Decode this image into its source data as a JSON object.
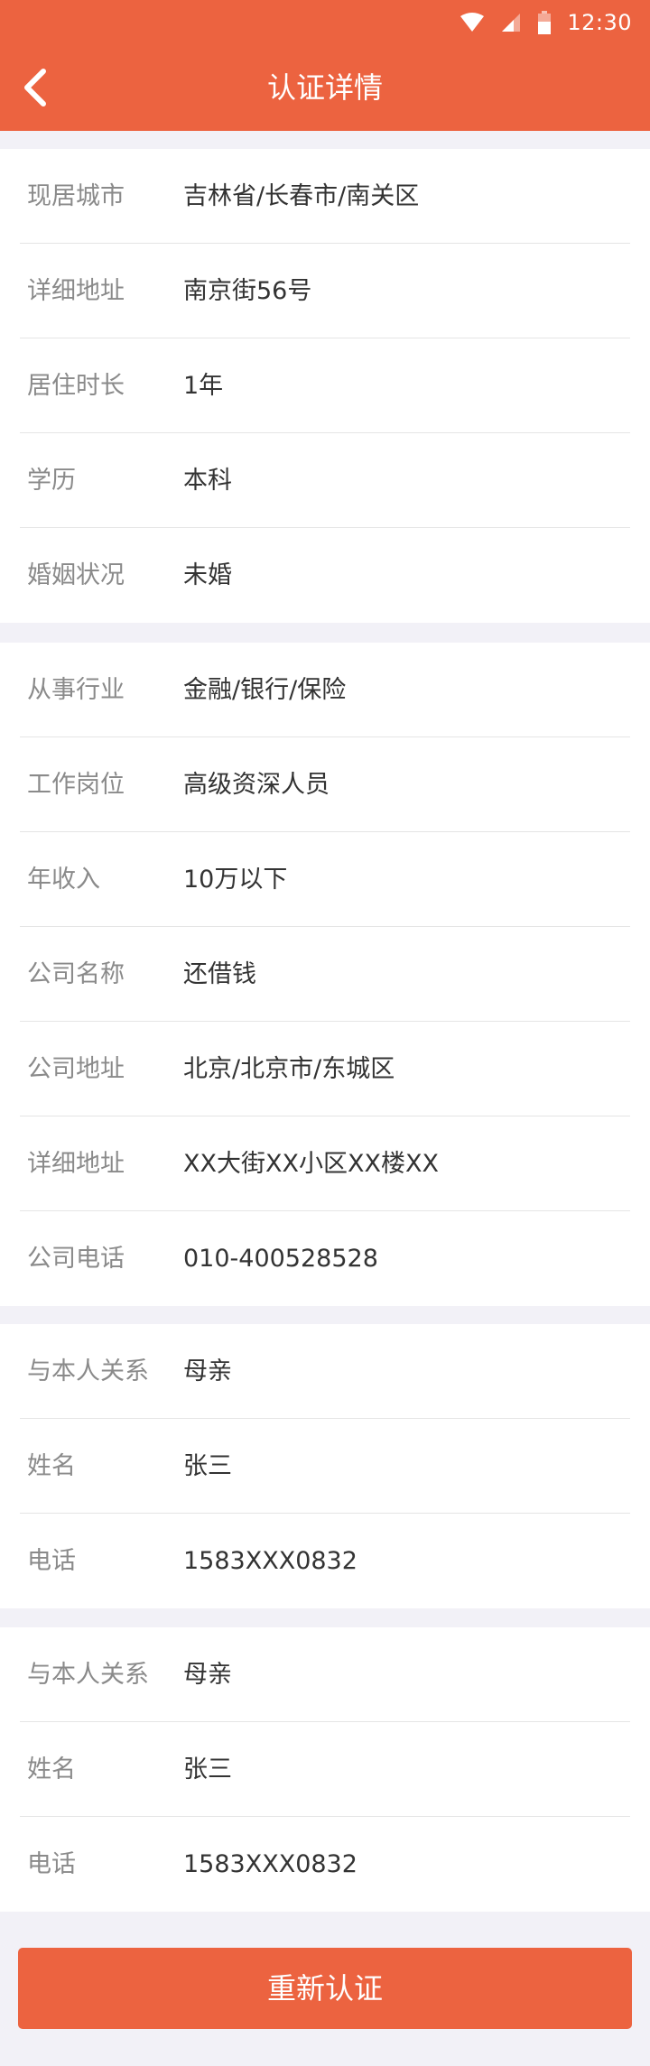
{
  "status_bar": {
    "time": "12:30"
  },
  "header": {
    "title": "认证详情",
    "back_icon": "chevron-left-icon"
  },
  "residence": [
    {
      "label": "现居城市",
      "value": "吉林省/长春市/南关区"
    },
    {
      "label": "详细地址",
      "value": "南京街56号"
    },
    {
      "label": "居住时长",
      "value": "1年"
    },
    {
      "label": "学历",
      "value": "本科"
    },
    {
      "label": "婚姻状况",
      "value": "未婚"
    }
  ],
  "work": [
    {
      "label": "从事行业",
      "value": "金融/银行/保险"
    },
    {
      "label": "工作岗位",
      "value": "高级资深人员"
    },
    {
      "label": "年收入",
      "value": "10万以下"
    },
    {
      "label": "公司名称",
      "value": "还借钱"
    },
    {
      "label": "公司地址",
      "value": "北京/北京市/东城区"
    },
    {
      "label": "详细地址",
      "value": "XX大街XX小区XX楼XX"
    },
    {
      "label": "公司电话",
      "value": "010-400528528"
    }
  ],
  "contact1": [
    {
      "label": "与本人关系",
      "value": "母亲"
    },
    {
      "label": "姓名",
      "value": "张三"
    },
    {
      "label": "电话",
      "value": "1583XXX0832"
    }
  ],
  "contact2": [
    {
      "label": "与本人关系",
      "value": "母亲"
    },
    {
      "label": "姓名",
      "value": "张三"
    },
    {
      "label": "电话",
      "value": "1583XXX0832"
    }
  ],
  "footer": {
    "button_label": "重新认证"
  },
  "colors": {
    "accent": "#ec6340",
    "background": "#f2f1f7"
  }
}
